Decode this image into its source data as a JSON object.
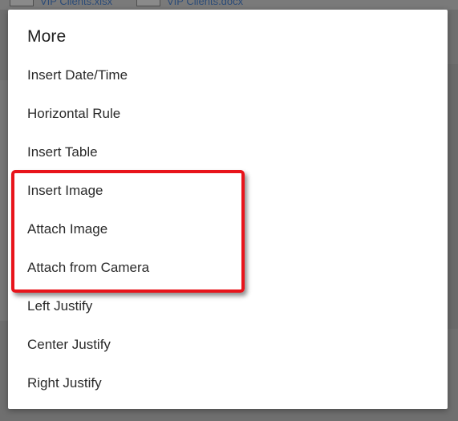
{
  "background": {
    "attachments": [
      {
        "label": "VIP Clients.xlsx"
      },
      {
        "label": "VIP Clients.docx"
      }
    ]
  },
  "dialog": {
    "title": "More",
    "items": [
      {
        "label": "Insert Date/Time"
      },
      {
        "label": "Horizontal Rule"
      },
      {
        "label": "Insert Table"
      },
      {
        "label": "Insert Image"
      },
      {
        "label": "Attach Image"
      },
      {
        "label": "Attach from Camera"
      },
      {
        "label": "Left Justify"
      },
      {
        "label": "Center Justify"
      },
      {
        "label": "Right Justify"
      }
    ]
  },
  "annotation": {
    "highlight_color": "#e8141b"
  },
  "colors": {
    "dialog_bg": "#ffffff",
    "scrim": "#6f6f6f",
    "text": "#2a2a2a"
  }
}
